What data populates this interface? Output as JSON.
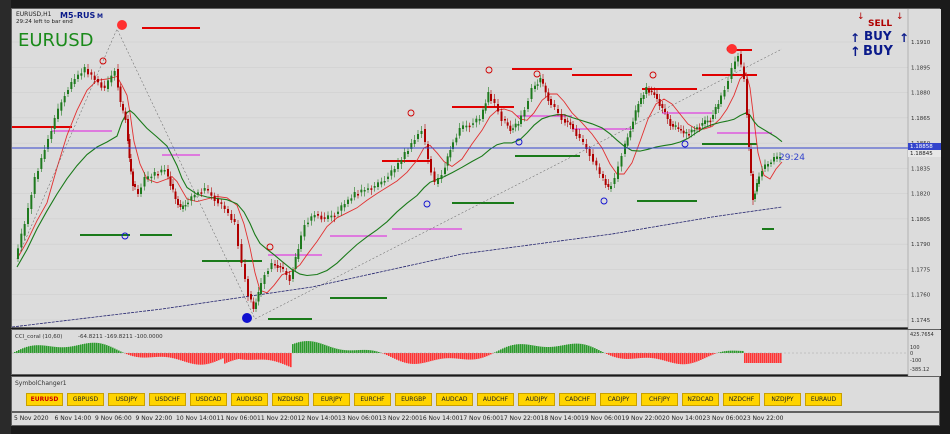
{
  "header": {
    "symbol_tf": "EURUSD,H1",
    "indicator_name": "M5-RUS",
    "indicator_suffix": "M",
    "countdown": "29:24 left to bar end",
    "big_symbol": "EURUSD"
  },
  "signals": {
    "sell": "SELL",
    "buy1": "BUY",
    "buy2": "BUY",
    "sell_color": "#b00000",
    "buy_color": "#0a1a8a"
  },
  "price_axis": {
    "labels": [
      "1.1910",
      "1.1895",
      "1.1880",
      "1.1865",
      "1.1850",
      "1.1835",
      "1.1820",
      "1.1805",
      "1.1790",
      "1.1775",
      "1.1760",
      "1.1745"
    ],
    "current_price": "1.18858",
    "current_price2": "1.18845",
    "timer_text": "29:24"
  },
  "oscillator": {
    "title": "CCI_coral (10,60)",
    "values": "-64.8211  -169.8211  -100.0000",
    "right_labels": [
      "425.7654",
      "100",
      "0",
      "-100",
      "-385.12"
    ]
  },
  "symbol_changer": {
    "title": "SymbolChanger1",
    "buttons": [
      "EURUSD",
      "GBPUSD",
      "USDJPY",
      "USDCHF",
      "USDCAD",
      "AUDUSD",
      "NZDUSD",
      "EURJPY",
      "EURCHF",
      "EURGBP",
      "AUDCAD",
      "AUDCHF",
      "AUDJPY",
      "CADCHF",
      "CADJPY",
      "CHFJPY",
      "NZDCAD",
      "NZDCHF",
      "NZDJPY",
      "EURAUD"
    ]
  },
  "time_axis": {
    "labels": [
      "5 Nov 2020",
      "6 Nov 14:00",
      "9 Nov 06:00",
      "9 Nov 22:00",
      "10 Nov 14:00",
      "11 Nov 06:00",
      "11 Nov 22:00",
      "12 Nov 14:00",
      "13 Nov 06:00",
      "13 Nov 22:00",
      "16 Nov 14:00",
      "17 Nov 06:00",
      "17 Nov 22:00",
      "18 Nov 14:00",
      "19 Nov 06:00",
      "19 Nov 22:00",
      "20 Nov 14:00",
      "23 Nov 06:00",
      "23 Nov 22:00"
    ]
  },
  "colors": {
    "bull": "#1e7a1e",
    "bear": "#b00000",
    "sma_fast": "#e23030",
    "sma_mid": "#1a7a1a",
    "sma_slow": "#23236e",
    "current_price_line": "#3344cc",
    "level_red": "#e00000",
    "level_green": "#1a7a1a",
    "level_magenta": "#e040e0",
    "cci_green": "#2a9a2a",
    "cci_red": "#ff3333"
  }
}
